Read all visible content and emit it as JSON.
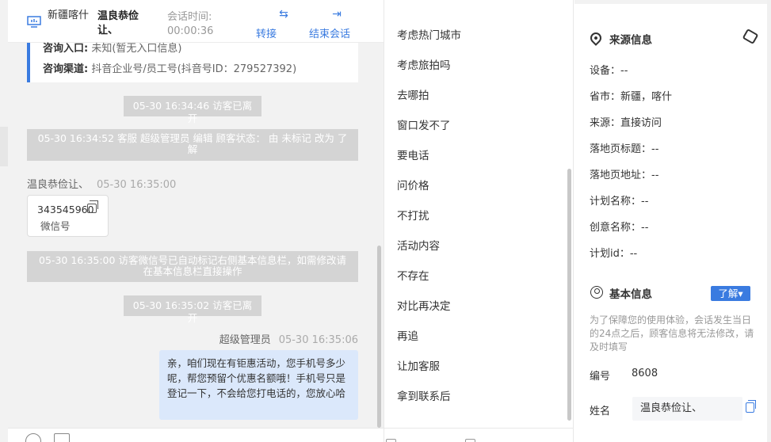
{
  "header": {
    "region": "新疆喀什",
    "visitor_name": "温良恭俭让、",
    "session_time_label": "会话时间:",
    "session_time_value": "00:00:36",
    "transfer_label": "转接",
    "end_label": "结束会话"
  },
  "info_card": {
    "entry_label": "咨询入口:",
    "entry_value": "未知(暂无入口信息)",
    "channel_label": "咨询渠道:",
    "channel_value": "抖音企业号/员工号(抖音号ID：279527392)"
  },
  "messages": {
    "sys1": "05-30 16:34:46 访客已离开",
    "sys2": "05-30 16:34:52 客服 超级管理员 编辑 顾客状态： 由 未标记 改为 了解",
    "visitor_name": "温良恭俭让、",
    "visitor_time": "05-30 16:35:00",
    "wechat_number": "343545960",
    "wechat_label": "微信号",
    "sys3": "05-30 16:35:00 访客微信号已自动标记右侧基本信息栏，如需修改请在基本信息栏直接操作",
    "sys4": "05-30 16:35:02 访客已离开",
    "agent_name": "超级管理员",
    "agent_time": "05-30 16:35:06",
    "agent_text": "亲，咱们现在有钜惠活动，您手机号多少呢，帮您预留个优惠名额哦！手机号只是登记一下，不会给您打电话的，您放心哈"
  },
  "quick_replies": [
    "考虑热门城市",
    "考虑旅拍吗",
    "去哪拍",
    "窗口发不了",
    "要电话",
    "问价格",
    "不打扰",
    "活动内容",
    "不存在",
    "对比再决定",
    "再追",
    "让加客服",
    "拿到联系后"
  ],
  "source_info": {
    "title": "来源信息",
    "device": "设备：--",
    "province": "省市：新疆，喀什",
    "source": "来源：直接访问",
    "landing_title": "落地页标题：--",
    "landing_url": "落地页地址：--",
    "plan_name": "计划名称：--",
    "creative_name": "创意名称：--",
    "plan_id": "计划id：--"
  },
  "basic_info": {
    "title": "基本信息",
    "status_button": "了解▾",
    "hint": "为了保障您的使用体验，会话发生当日的24点之后，顾客信息将无法修改，请及时填写",
    "id_label": "编号",
    "id_value": "8608",
    "name_label": "姓名",
    "name_value": "温良恭俭让、"
  },
  "colors": {
    "accent": "#3a7be0",
    "bubble": "#dbe8fb",
    "system_msg": "#d4d4d4"
  }
}
